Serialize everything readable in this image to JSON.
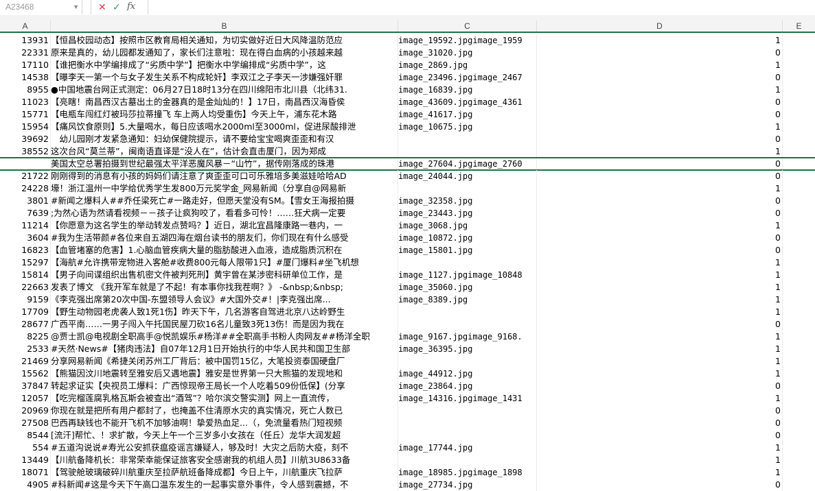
{
  "formula_bar": {
    "name_box": "A23468",
    "cancel_icon": "✕",
    "enter_icon": "✓",
    "fx_label": "fx",
    "formula": ""
  },
  "columns": [
    "A",
    "B",
    "C",
    "D",
    "E"
  ],
  "rows": [
    {
      "a": "13931",
      "b": "【恒昌校园动态】按照市区教育局相关通知，为切实做好近日大风降温防范应",
      "c": "image_19592.jpgimage_1959",
      "d": "1"
    },
    {
      "a": "22331",
      "b": "原来是真的，幼儿园都发通知了，家长们注意啦：现在得白血病的小孩越来越",
      "c": "image_31020.jpg",
      "d": "0"
    },
    {
      "a": "17110",
      "b": "【谁把衡水中学编排成了“劣质中学”】把衡水中学编排成“劣质中学”，这",
      "c": "image_2869.jpg",
      "d": "1"
    },
    {
      "a": "14538",
      "b": "【曝李天一第一个与女子发生关系不构成轮奸】李双江之子李天一涉嫌强奸罪",
      "c": "image_23496.jpgimage_2467",
      "d": "0"
    },
    {
      "a": "8955",
      "b": "●中国地震台网正式测定：06月27日18时13分在四川绵阳市北川县（北纬31.",
      "c": "image_16839.jpg",
      "d": "1"
    },
    {
      "a": "11023",
      "b": "【亮瞎！南昌西汉古墓出土的金器真的是金灿灿的！】17日，南昌西汉海昏侯",
      "c": "image_43609.jpgimage_4361",
      "d": "0"
    },
    {
      "a": "15771",
      "b": "【电瓶车闯红灯被玛莎拉蒂撞飞 车上两人均受重伤】今天上午，浦东花木路",
      "c": "image_41617.jpg",
      "d": "0"
    },
    {
      "a": "15954",
      "b": "【痛风饮食原则】5.大量喝水，每日应该喝水2000ml至3000ml，促进尿酸排泄",
      "c": "image_10675.jpg",
      "d": "1"
    },
    {
      "a": "39692",
      "b": "　幼儿园刚才发紧急通知：妇幼保健院提示，请不要给宝宝喝爽歪歪和有汉",
      "c": "",
      "d": "0"
    },
    {
      "a": "38552",
      "b": "这次台风“莫兰蒂”，闽南语直译是“没人在”，估计会直击厦门，因为郑成",
      "c": "",
      "d": "1"
    },
    {
      "a": "",
      "b": "美国太空总署拍摄到世纪最强太平洋恶魔风暴－“山竹”，据传刚落成的珠港",
      "c": "image_27604.jpgimage_2760",
      "d": "0",
      "selected": true
    },
    {
      "a": "21722",
      "b": "刚刚得到的消息有小孩的妈妈们请注意了爽歪歪可口可乐雅培多美滋娃哈哈AD",
      "c": "image_24044.jpg",
      "d": "0"
    },
    {
      "a": "24228",
      "b": "壕！浙江温州一中学给优秀学生发800万元奖学金_网易新闻（分享自@网易新",
      "c": "",
      "d": "1"
    },
    {
      "a": "3801",
      "b": "#新闻之爆料人##乔任梁死亡#一路走好，但愿天堂没有SM。【雪女王海报拍摄",
      "c": "image_32358.jpg",
      "d": "0"
    },
    {
      "a": "7639",
      "b": ";为然心语为然请看视频－－孩子让疯狗咬了，看看多可怜！……狂犬病一定要",
      "c": "image_23443.jpg",
      "d": "0"
    },
    {
      "a": "11214",
      "b": "【你愿意为这名学生的举动转发点赞吗？】近日，湖北宜昌隆康路一巷内，一",
      "c": "image_3068.jpg",
      "d": "1"
    },
    {
      "a": "3604",
      "b": "#我为生活带颜#各位来自五湖四海在烟台读书的朋友们，你们现在有什么感受",
      "c": "image_10872.jpg",
      "d": "0"
    },
    {
      "a": "16823",
      "b": "【血管堵塞的危害】1.心脑血管疾病大量的脂肪酸进入血液，造成脂质沉积在",
      "c": "image_15801.jpg",
      "d": "0"
    },
    {
      "a": "15297",
      "b": "【海航#允许携带宠物进入客舱#收费800元每人限带1只】#厦门爆料#坐飞机想",
      "c": "",
      "d": "1"
    },
    {
      "a": "15814",
      "b": "【男子向间谍组织出售机密文件被判死刑】黄宇曾在某涉密科研单位工作，是",
      "c": "image_1127.jpgimage_10848",
      "d": "1"
    },
    {
      "a": "22663",
      "b": "发表了博文 《我开军车就是了不起！有本事你找我茬啊？》 -&nbsp;&nbsp;",
      "c": "image_35060.jpg",
      "d": "1"
    },
    {
      "a": "9159",
      "b": "《李克强出席第20次中国-东盟领导人会议》#大国外交#！|李克强出席...",
      "c": "image_8389.jpg",
      "d": "1"
    },
    {
      "a": "17709",
      "b": "【野生动物园老虎袭人致1死1伤】昨天下午，几名游客自驾进北京八达岭野生",
      "c": "",
      "d": "1"
    },
    {
      "a": "28677",
      "b": "广西平南……一男子闯入午托国民屋刀砍16名儿童致3死13伤！而是因为我在",
      "c": "",
      "d": "0"
    },
    {
      "a": "8225",
      "b": "@贾士凯@电视剧全职高手@悦凯娱乐#杨洋##全职高手书粉人肉网友##杨洋全职",
      "c": "image_9167.jpgimage_9168.",
      "d": "1"
    },
    {
      "a": "2533",
      "b": "#天然·News#【猪肉违法】自07年12月1日开始执行的中华人民共和国卫生部",
      "c": "image_36395.jpg",
      "d": "1"
    },
    {
      "a": "21469",
      "b": "分享网易新闻《希捷关闭苏州工厂背后：被中国罚15亿，大笔投资泰国硬盘厂",
      "c": "",
      "d": "1"
    },
    {
      "a": "15562",
      "b": "【熊猫因汶川地震转至雅安后又遇地震】雅安是世界第一只大熊猫的发现地和",
      "c": "image_44912.jpg",
      "d": "1"
    },
    {
      "a": "37847",
      "b": "转起求证实【央视员工爆料：广西惊现帝王局长一个人吃着509份低保】(分享",
      "c": "image_23864.jpg",
      "d": "0"
    },
    {
      "a": "12057",
      "b": "【吃完榴莲腐乳格瓦斯会被查出“酒驾”？哈尔滨交警实测】网上一直流传，",
      "c": "image_14316.jpgimage_1431",
      "d": "1"
    },
    {
      "a": "20969",
      "b": "你现在就是把所有用户都封了，也掩盖不住清原水灾的真实情况，死亡人数已",
      "c": "",
      "d": "0"
    },
    {
      "a": "27508",
      "b": "巴西再缺钱也不能开飞机不加够油啊！挚爱热血足...（，免流量看热门短视频",
      "c": "",
      "d": "0"
    },
    {
      "a": "8544",
      "b": "[流汗]帮忙、！求扩散，今天上午一个三岁多小女孩在（任丘）龙华大润发超",
      "c": "",
      "d": "0"
    },
    {
      "a": "554",
      "b": "#五道沟说说#寿光公安抓获瘟疫谣言嫌疑人，够及时！大灾之后防大疫，刻不",
      "c": "image_17744.jpg",
      "d": "1"
    },
    {
      "a": "13449",
      "b": "【川航备降机长：非常荣幸能保证旅客安全感谢我的机组人员】川航3U8633备",
      "c": "",
      "d": "1"
    },
    {
      "a": "18071",
      "b": "【驾驶舱玻璃破碎川航重庆至拉萨航班备降成都】今日上午，川航重庆飞拉萨",
      "c": "image_18985.jpgimage_1898",
      "d": "1"
    },
    {
      "a": "4905",
      "b": "#科新闻#这是今天下午高口温东发生的一起事实意外事件，令人感到震撼，不",
      "c": "image_27734.jpg",
      "d": "0"
    }
  ]
}
